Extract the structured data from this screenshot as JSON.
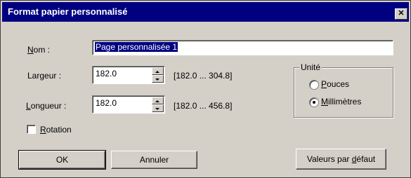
{
  "window": {
    "title": "Format papier personnalisé",
    "close_glyph": "✕"
  },
  "name": {
    "label": "Nom :",
    "value": "Page personnalisée 1"
  },
  "width": {
    "label": "Largeur :",
    "value": "182.0",
    "range": "[182.0 ... 304.8]"
  },
  "length": {
    "label": "Longueur :",
    "value": "182.0",
    "range": "[182.0 ... 456.8]"
  },
  "rotation": {
    "label": "Rotation",
    "checked": false
  },
  "unit": {
    "title": "Unité",
    "options": [
      {
        "label": "Pouces",
        "selected": false
      },
      {
        "label": "Millimètres",
        "selected": true
      }
    ]
  },
  "buttons": {
    "ok": "OK",
    "cancel": "Annuler",
    "defaults": "Valeurs par défaut"
  }
}
